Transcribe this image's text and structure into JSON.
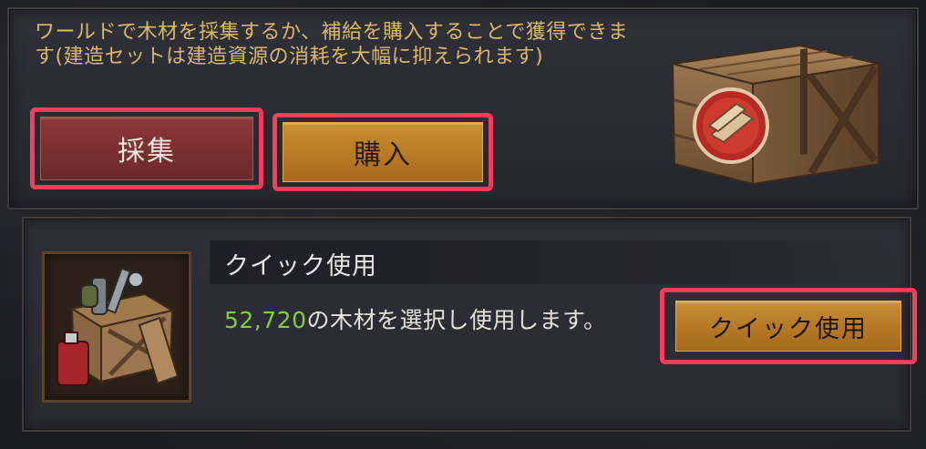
{
  "supply": {
    "description": "ワールドで木材を採集するか、補給を購入することで獲得できます(建造セットは建造資源の消耗を大幅に抑えられます)",
    "gather_label": "採集",
    "buy_label": "購入",
    "image_icon": "wood-crate-icon"
  },
  "quick_use": {
    "title": "クイック使用",
    "amount": "52,720",
    "desc_suffix": "の木材を選択し使用します。",
    "button_label": "クイック使用",
    "image_icon": "resource-crate-icon"
  },
  "colors": {
    "text_gold": "#d9b86a",
    "amount_green": "#7fcf3d",
    "gather_red": "#7a2f2f",
    "buy_gold": "#b97b25",
    "highlight_pink": "#ff3b5c"
  }
}
